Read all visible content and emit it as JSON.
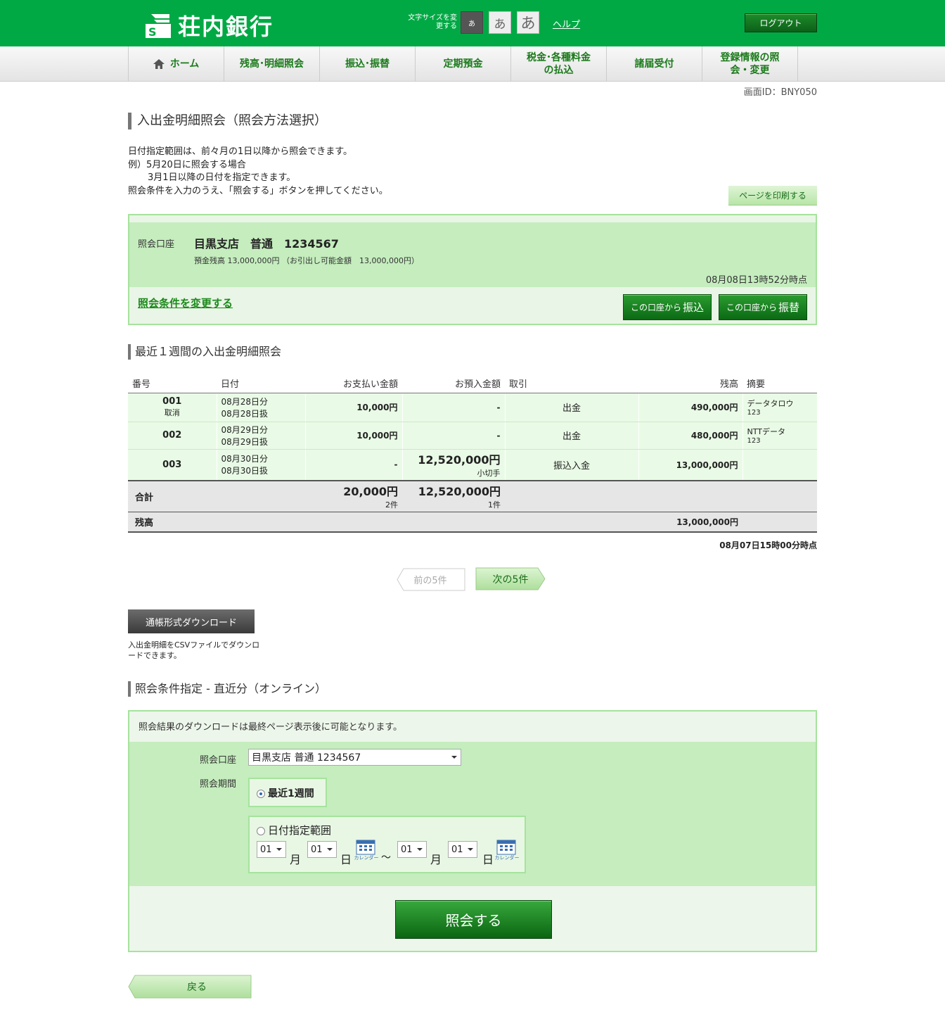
{
  "header": {
    "bank_name": "荘内銀行",
    "font_size_label": "文字サイズを変更する",
    "font_size_small": "あ",
    "font_size_medium": "あ",
    "font_size_large": "あ",
    "help": "ヘルプ",
    "logout": "ログアウト"
  },
  "nav": {
    "items": [
      {
        "label": "ホーム"
      },
      {
        "label": "残高･明細照会"
      },
      {
        "label": "振込･振替"
      },
      {
        "label": "定期預金"
      },
      {
        "label": "税金･各種料金の払込"
      },
      {
        "label": "諸届受付"
      },
      {
        "label": "登録情報の照会・変更"
      }
    ]
  },
  "screen_id": "画面ID：BNY050",
  "page_title": "入出金明細照会（照会方法選択）",
  "intro": {
    "line1": "日付指定範囲は、前々月の1日以降から照会できます。",
    "line2": "例）5月20日に照会する場合",
    "line3": "3月1日以降の日付を指定できます。",
    "line4": "照会条件を入力のうえ、「照会する」ボタンを押してください。"
  },
  "print_button": "ページを印刷する",
  "account": {
    "label": "照会口座",
    "name": "目黒支店　普通　1234567",
    "balance_line": "預金残高 13,000,000円 （お引出し可能金額　13,000,000円）",
    "as_of": "08月08日13時52分時点",
    "change_link": "照会条件を変更する",
    "transfer_btn_prefix": "この口座から",
    "transfer_btn_word": "振込",
    "furikae_btn_prefix": "この口座から",
    "furikae_btn_word": "振替"
  },
  "statement": {
    "title": "最近１週間の入出金明細照会",
    "headers": {
      "no": "番号",
      "date": "日付",
      "payment": "お支払い金額",
      "deposit": "お預入金額",
      "txn": "取引",
      "balance": "残高",
      "memo": "摘要"
    },
    "rows": [
      {
        "no": "001",
        "status": "取消",
        "date1": "08月28日分",
        "date2": "08月28日扱",
        "payment": "10,000円",
        "deposit": "-",
        "deposit_note": "",
        "txn": "出金",
        "balance": "490,000円",
        "memo1": "データタロウ",
        "memo2": "123"
      },
      {
        "no": "002",
        "status": "",
        "date1": "08月29日分",
        "date2": "08月29日扱",
        "payment": "10,000円",
        "deposit": "-",
        "deposit_note": "",
        "txn": "出金",
        "balance": "480,000円",
        "memo1": "NTTデータ",
        "memo2": "123"
      },
      {
        "no": "003",
        "status": "",
        "date1": "08月30日分",
        "date2": "08月30日扱",
        "payment": "-",
        "deposit": "12,520,000円",
        "deposit_note": "小切手",
        "txn": "振込入金",
        "balance": "13,000,000円",
        "memo1": "",
        "memo2": ""
      }
    ],
    "total_label": "合計",
    "total_payment": "20,000円",
    "total_payment_count": "2件",
    "total_deposit": "12,520,000円",
    "total_deposit_count": "1件",
    "balance_label": "残高",
    "balance_value": "13,000,000円",
    "as_of": "08月07日15時00分時点"
  },
  "pager": {
    "prev": "前の5件",
    "next": "次の5件"
  },
  "download": {
    "button": "通帳形式ダウンロード",
    "note": "入出金明細をCSVファイルでダウンロードできます。"
  },
  "query_form": {
    "title": "照会条件指定 - 直近分（オンライン）",
    "note": "照会結果のダウンロードは最終ページ表示後に可能となります。",
    "account_label": "照会口座",
    "account_value": "目黒支店 普通 1234567",
    "period_label": "照会期間",
    "option_recent": "最近1週間",
    "option_range": "日付指定範囲",
    "from_month": "01",
    "from_day": "01",
    "to_month": "01",
    "to_day": "01",
    "month_unit": "月",
    "day_unit": "日",
    "tilde": "～",
    "calendar_label": "カレンダー",
    "submit": "照会する"
  },
  "back_button": "戻る"
}
